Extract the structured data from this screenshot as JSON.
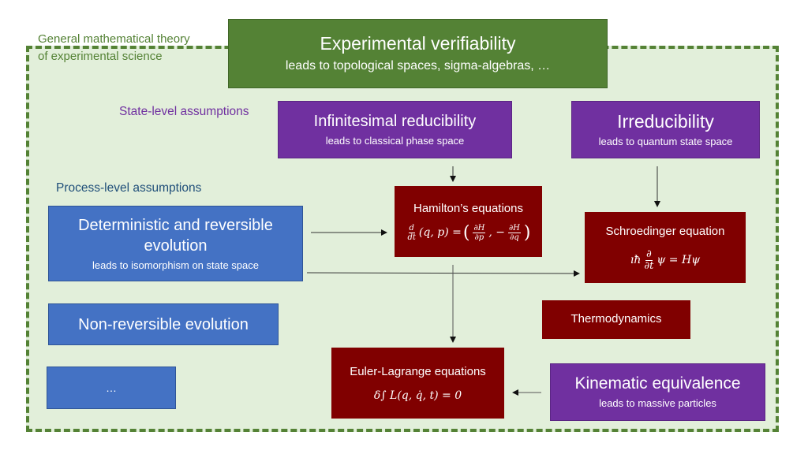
{
  "outer_label": [
    "General mathematical theory",
    "of experimental science"
  ],
  "section_labels": {
    "state": "State-level assumptions",
    "process": "Process-level assumptions"
  },
  "colors": {
    "container_fill": "#e2efda",
    "container_border": "#548235",
    "state_label": "#7030a0",
    "process_label": "#1f4e79",
    "green_box": "#548235",
    "purple_box": "#7030a0",
    "blue_box": "#4472c4",
    "red_box": "#800000"
  },
  "boxes": {
    "experimental": {
      "title": "Experimental verifiability",
      "subtitle": "leads to topological spaces, sigma-algebras, …"
    },
    "infinitesimal": {
      "title": "Infinitesimal reducibility",
      "subtitle": "leads to classical phase space"
    },
    "irreducibility": {
      "title": "Irreducibility",
      "subtitle": "leads to quantum state space"
    },
    "deterministic": {
      "title_line1": "Deterministic and reversible",
      "title_line2": "evolution",
      "subtitle": "leads to isomorphism on state space"
    },
    "nonreversible": {
      "title": "Non-reversible evolution"
    },
    "ellipsis": {
      "title": "…"
    },
    "hamilton": {
      "title": "Hamilton’s equations",
      "eq_lhs_num": "d",
      "eq_lhs_den": "dt",
      "eq_args": "(q, p) =",
      "eq_f1_num": "∂H",
      "eq_f1_den": "∂p",
      "eq_sep": ", −",
      "eq_f2_num": "∂H",
      "eq_f2_den": "∂q"
    },
    "schroedinger": {
      "title": "Schroedinger equation",
      "eq_prefix": "ıħ",
      "eq_num": "∂",
      "eq_den": "∂t",
      "eq_suffix": "ψ = Hψ"
    },
    "thermodynamics": {
      "title": "Thermodynamics"
    },
    "euler_lagrange": {
      "title": "Euler-Lagrange equations",
      "equation": "δ∫ L(q, q̇, t) = 0"
    },
    "kinematic": {
      "title": "Kinematic equivalence",
      "subtitle": "leads to massive particles"
    }
  }
}
